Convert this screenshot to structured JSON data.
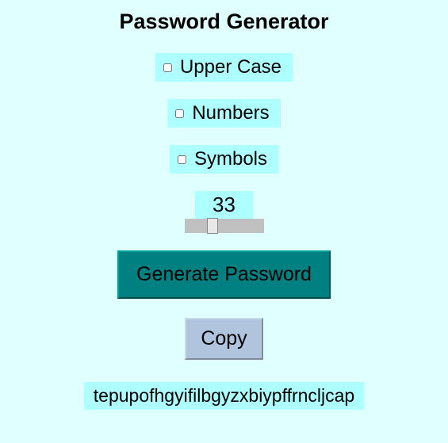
{
  "title": "Password Generator",
  "options": {
    "uppercase": {
      "label": "Upper Case",
      "checked": false
    },
    "numbers": {
      "label": "Numbers",
      "checked": false
    },
    "symbols": {
      "label": "Symbols",
      "checked": false
    }
  },
  "length": {
    "value": "33",
    "min": "1",
    "max": "64"
  },
  "buttons": {
    "generate": "Generate Password",
    "copy": "Copy"
  },
  "output": "tepupofhgyifilbgyzxbiypffrncljcap"
}
